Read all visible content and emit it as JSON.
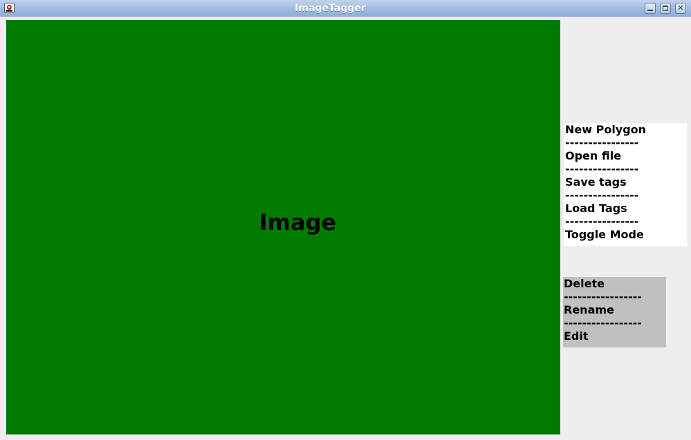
{
  "window": {
    "title": "ImageTagger",
    "icon": "java-app-icon",
    "controls": [
      "minimize-icon",
      "maximize-icon",
      "close-icon"
    ],
    "control_glyphs": {
      "close": "✕"
    }
  },
  "image_panel": {
    "label": "Image",
    "background": "#007b00"
  },
  "main_menu": {
    "background": "#ffffff",
    "items": [
      {
        "label": "New Polygon"
      },
      {
        "label": "Open file"
      },
      {
        "label": "Save tags"
      },
      {
        "label": "Load Tags"
      },
      {
        "label": "Toggle Mode"
      }
    ],
    "separator": "----------------"
  },
  "context_menu": {
    "background": "#c0c0c0",
    "items": [
      {
        "label": "Delete"
      },
      {
        "label": "Rename"
      },
      {
        "label": "Edit"
      }
    ],
    "separator": "-----------------"
  }
}
